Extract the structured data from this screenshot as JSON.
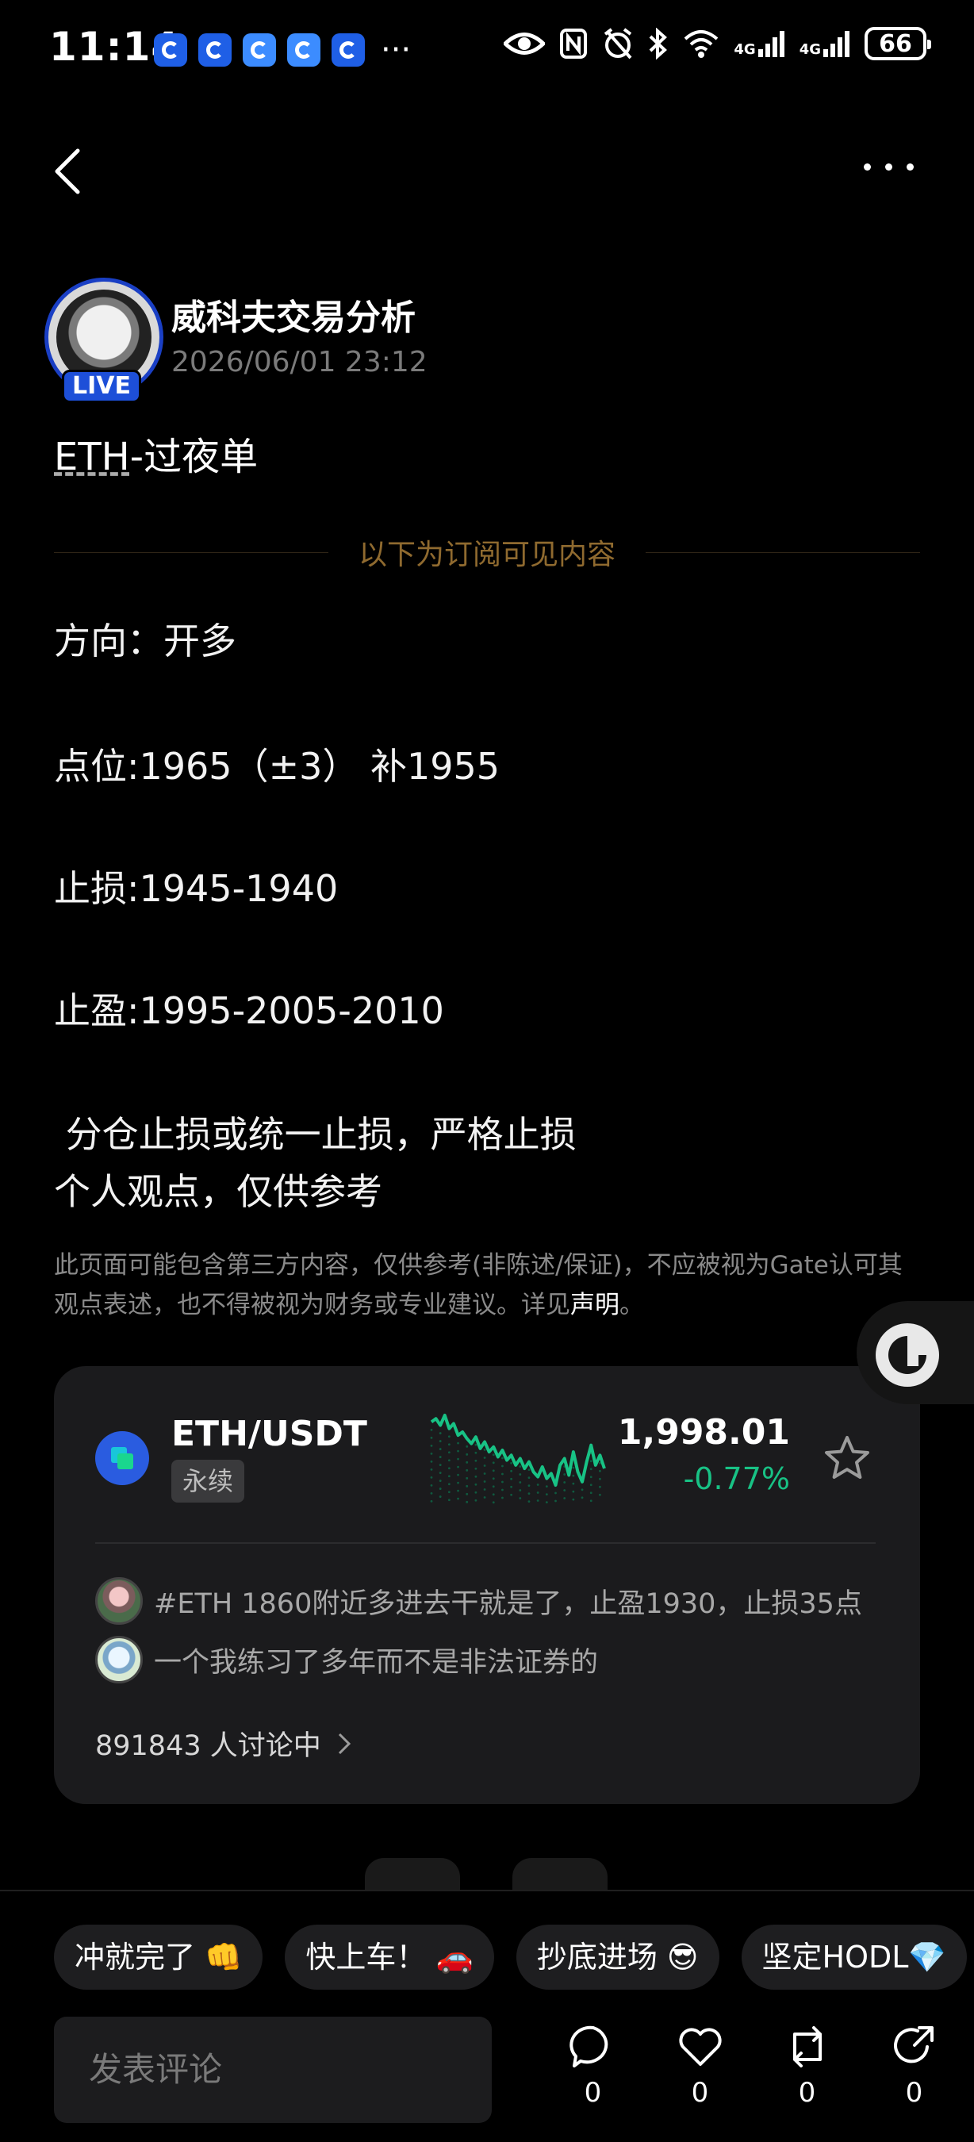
{
  "status_bar": {
    "time": "11:14",
    "more": "···",
    "network_1": "4G",
    "network_2": "4G",
    "battery": "66",
    "icons": [
      "app-notification-icon",
      "eye-icon",
      "nfc-icon",
      "alarm-off-icon",
      "bluetooth-icon",
      "wifi-icon",
      "signal-icon",
      "battery-icon"
    ]
  },
  "header": {
    "back_icon": "chevron-left-icon",
    "more_icon": "more-horizontal-icon"
  },
  "author": {
    "name": "威科夫交易分析",
    "date": "2026/06/01 23:12",
    "live": "LIVE"
  },
  "post": {
    "title_tag": "ETH",
    "title_rest": "-过夜单",
    "divider_label": "以下为订阅可见内容",
    "lines": [
      "方向：开多",
      "点位:1965（±3） 补1955",
      "止损:1945-1940",
      "止盈:1995-2005-2010",
      " 分仓止损或统一止损，严格止损",
      "个人观点，仅供参考"
    ],
    "disclaimer": "此页面可能包含第三方内容，仅供参考(非陈述/保证)，不应被视为Gate认可其观点表述，也不得被视为财务或专业建议。详见",
    "disclaimer_link": "声明",
    "disclaimer_end": "。"
  },
  "market_card": {
    "pair": "ETH/USDT",
    "pair_type": "永续",
    "price": "1,998.01",
    "change": "-0.77%",
    "colors": {
      "up": "#18c285",
      "coin": "#2a5ce0"
    },
    "sparkline": [
      62,
      60,
      64,
      58,
      66,
      63,
      70,
      68,
      72,
      75,
      71,
      78,
      74,
      80,
      77,
      83,
      79,
      85,
      82,
      88,
      84,
      90,
      86,
      92,
      95,
      89,
      96,
      93,
      100,
      88,
      84,
      94,
      80,
      92,
      98,
      86,
      76,
      88,
      82,
      90
    ],
    "comments": [
      "#ETH 1860附近多进去干就是了，止盈1930，止损35点",
      "一个我练习了多年而不是非法证券的"
    ],
    "discussing": "891843 人讨论中"
  },
  "quick_replies": [
    "冲就完了 👊",
    "快上车！ 🚗",
    "抄底进场 😎",
    "坚定HODL💎"
  ],
  "comment_box": {
    "placeholder": "发表评论"
  },
  "actions": [
    {
      "icon": "comment-icon",
      "count": "0"
    },
    {
      "icon": "heart-icon",
      "count": "0"
    },
    {
      "icon": "repost-icon",
      "count": "0"
    },
    {
      "icon": "share-icon",
      "count": "0"
    }
  ]
}
